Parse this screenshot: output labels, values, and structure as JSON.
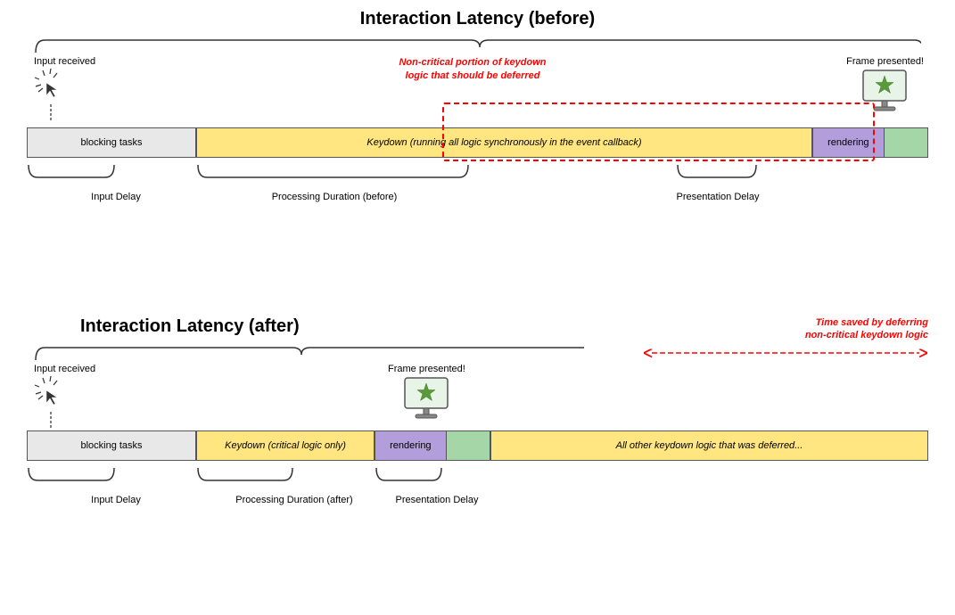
{
  "top": {
    "title": "Interaction Latency (before)",
    "input_received": "Input received",
    "frame_presented": "Frame presented!",
    "non_critical": "Non-critical portion of keydown\nlogic that should be deferred",
    "bar_blocking": "blocking tasks",
    "bar_keydown": "Keydown (running all logic synchronously in the event callback)",
    "bar_rendering": "rendering",
    "label_input_delay": "Input Delay",
    "label_processing": "Processing Duration (before)",
    "label_presentation": "Presentation Delay"
  },
  "bottom": {
    "title": "Interaction Latency (after)",
    "time_saved": "Time saved by deferring\nnon-critical keydown logic",
    "input_received": "Input received",
    "frame_presented": "Frame presented!",
    "bar_blocking": "blocking tasks",
    "bar_keydown": "Keydown (critical logic only)",
    "bar_rendering": "rendering",
    "bar_deferred": "All other keydown logic that was deferred...",
    "label_input_delay": "Input Delay",
    "label_processing": "Processing Duration (after)",
    "label_presentation": "Presentation Delay"
  }
}
